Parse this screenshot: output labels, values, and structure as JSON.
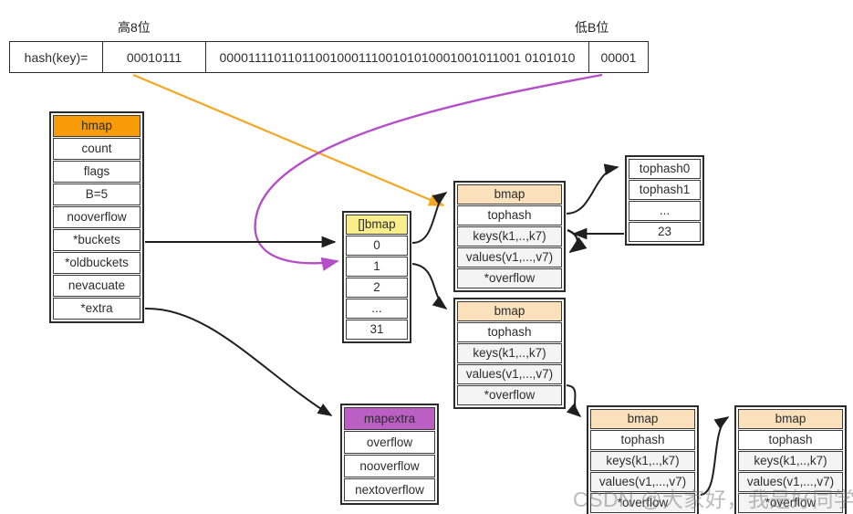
{
  "hash_row": {
    "label": "hash(key)=",
    "high_bits": "00010111",
    "middle_bits": "0000111101101100100011100101010001001011001 0101010",
    "low_bits": "00001",
    "caption_high": "高8位",
    "caption_low": "低B位"
  },
  "hmap": {
    "title": "hmap",
    "fields": [
      "count",
      "flags",
      "B=5",
      "nooverflow",
      "*buckets",
      "*oldbuckets",
      "nevacuate",
      "*extra"
    ]
  },
  "bmap_array": {
    "title": "[]bmap",
    "indices": [
      "0",
      "1",
      "2",
      "...",
      "31"
    ]
  },
  "bmap": {
    "title": "bmap",
    "fields": [
      "tophash",
      "keys(k1,..,k7)",
      "values(v1,...,v7)",
      "*overflow"
    ]
  },
  "tophash_detail": {
    "rows": [
      "tophash0",
      "tophash1",
      "...",
      "23"
    ]
  },
  "mapextra": {
    "title": "mapextra",
    "fields": [
      "overflow",
      "nooverflow",
      "nextoverflow"
    ]
  },
  "watermark": "CSDN @大家好，我是好同学",
  "colors": {
    "hmap_header": "#f79b08",
    "bmap_array_header": "#faee8c",
    "bmap_header": "#fae0bb",
    "mapextra_header": "#bc5fc4",
    "high_bits_arrow": "#f5a623",
    "low_bits_arrow": "#b44fc8",
    "edge": "#1f1f1f"
  }
}
